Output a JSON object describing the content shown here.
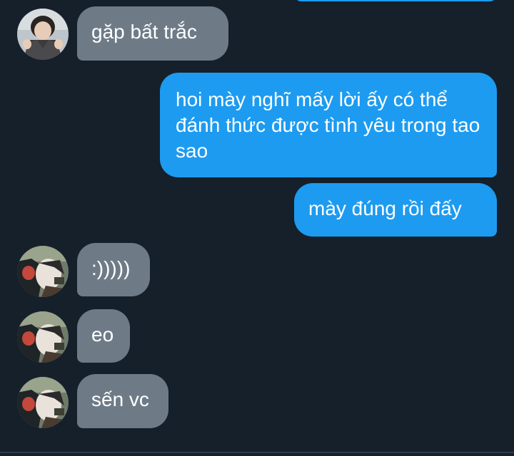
{
  "messages": [
    {
      "direction": "in",
      "text": "gặp bất trắc",
      "avatar": "user-boy-photo"
    },
    {
      "direction": "out",
      "text": "hoi mày nghĩ mấy lời ấy có thể đánh thức được tình yêu trong tao sao"
    },
    {
      "direction": "out",
      "text": "mày đúng rồi đấy"
    },
    {
      "direction": "in",
      "text": ":)))))",
      "avatar": "anime-villain-photo"
    },
    {
      "direction": "in",
      "text": "eo",
      "avatar": "anime-villain-photo"
    },
    {
      "direction": "in",
      "text": "sến vc",
      "avatar": "anime-villain-photo"
    }
  ],
  "colors": {
    "background": "#15202b",
    "incoming_bubble": "#6e7b87",
    "outgoing_bubble": "#1d9bf0",
    "text": "#ffffff"
  }
}
